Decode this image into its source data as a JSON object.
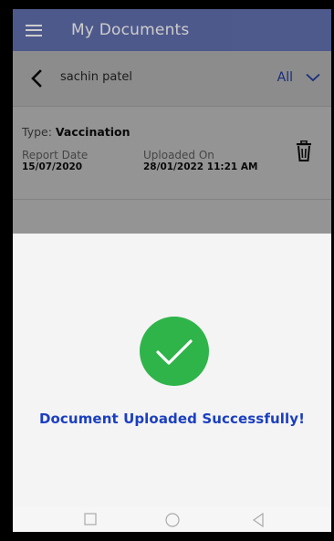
{
  "appbar": {
    "title": "My Documents",
    "menu_icon": "hamburger-menu-icon",
    "color": "#1a2f8a"
  },
  "filter_bar": {
    "back_icon": "chevron-left-icon",
    "patient_name": "sachin patel",
    "filter_value": "All",
    "dropdown_icon": "chevron-down-icon"
  },
  "document": {
    "type_label": "Type:",
    "type_value": "Vaccination",
    "report_date_label": "Report Date",
    "report_date_value": "15/07/2020",
    "uploaded_on_label": "Uploaded On",
    "uploaded_on_value": "28/01/2022 11:21 AM",
    "delete_icon": "trash-icon"
  },
  "dialog": {
    "icon": "check-circle-icon",
    "message": "Document Uploaded Successfully!",
    "accent": "#1b3fc0",
    "success_color": "#2fb44a"
  },
  "system_nav": {
    "recents_icon": "square-icon",
    "home_icon": "circle-icon",
    "back_icon": "triangle-back-icon"
  }
}
